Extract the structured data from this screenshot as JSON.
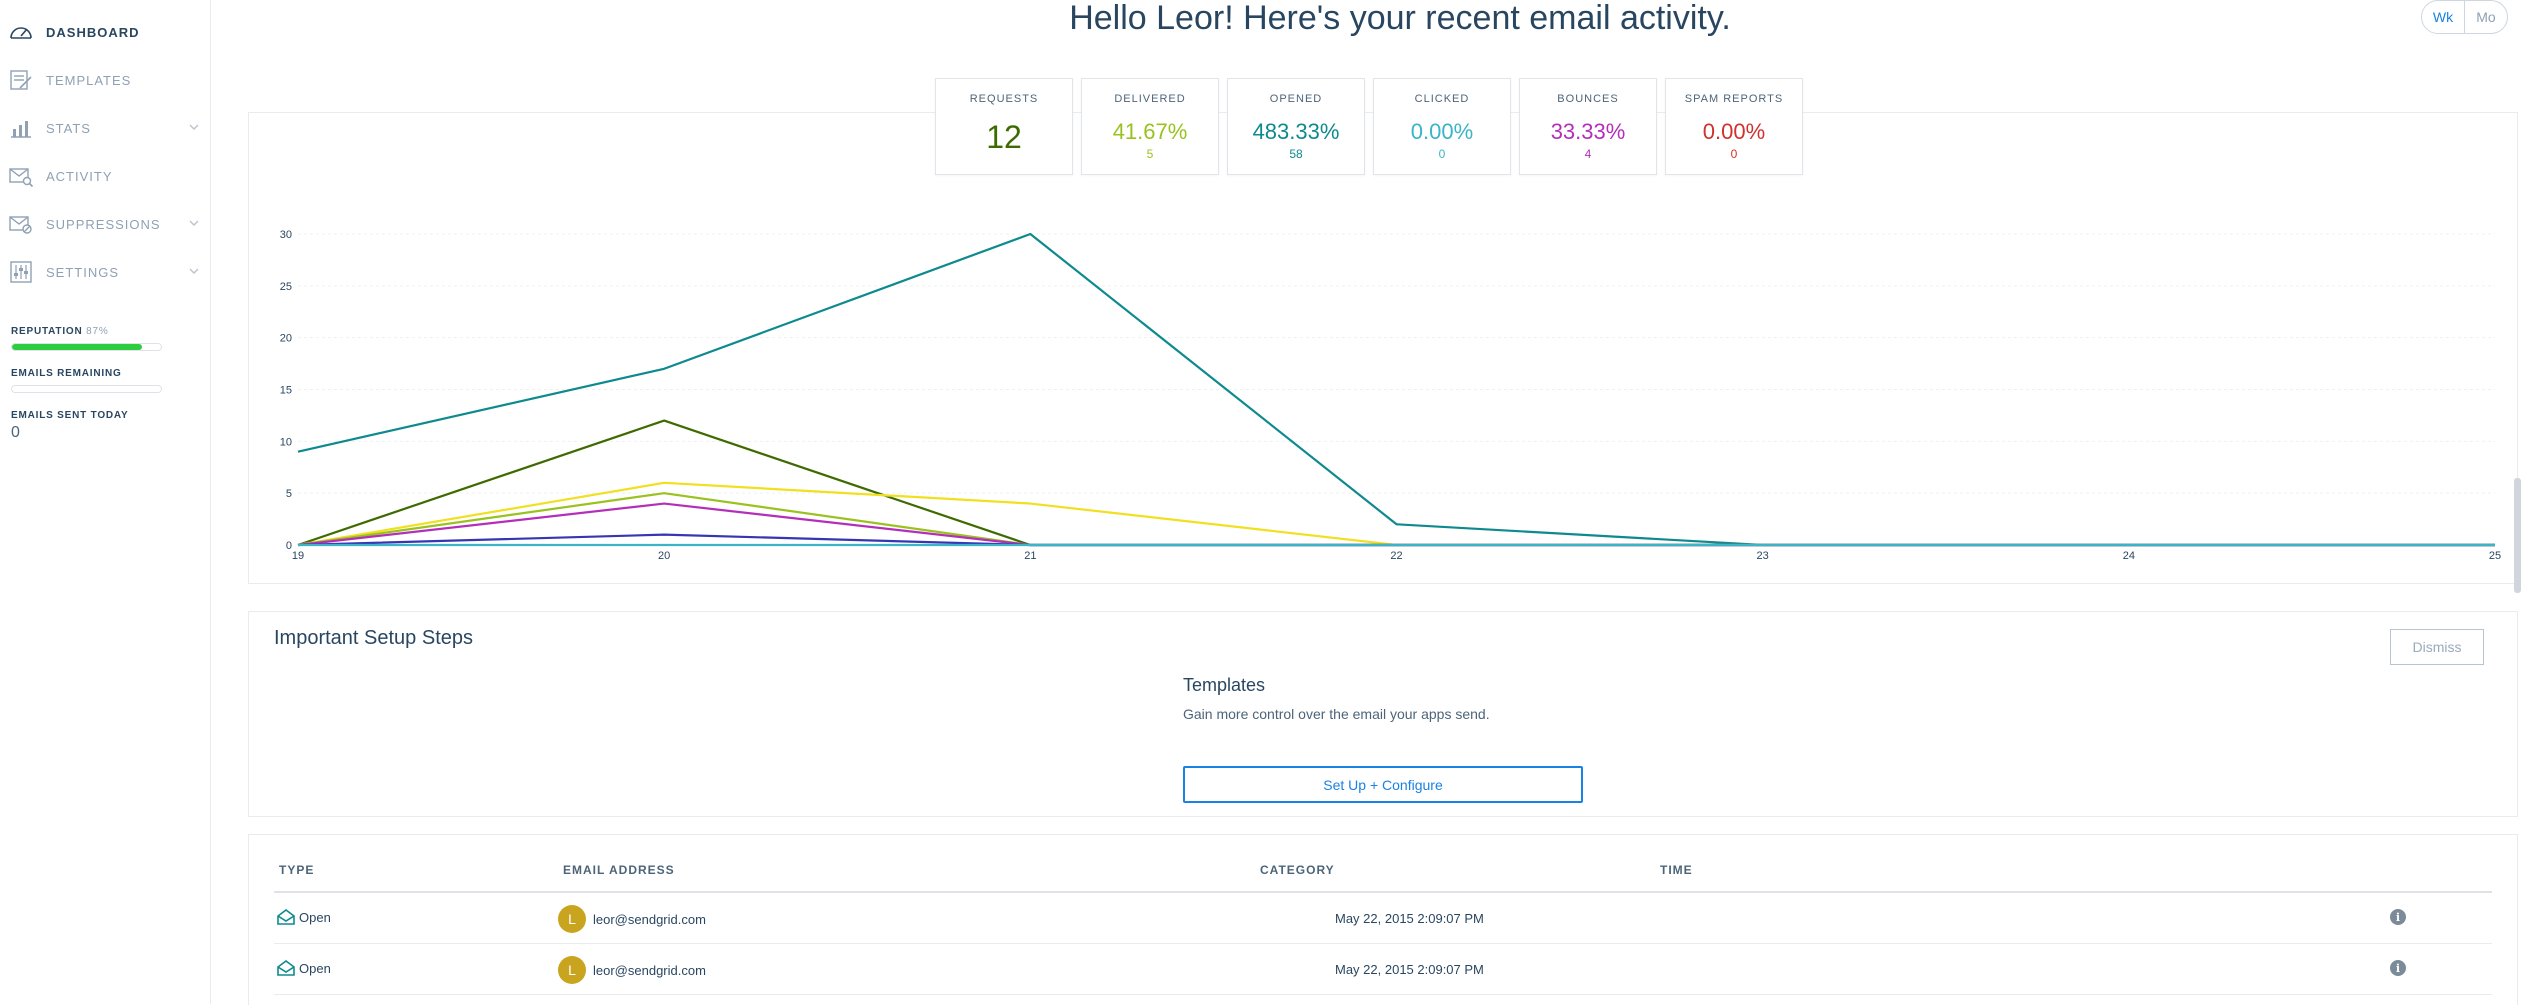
{
  "sidebar": {
    "items": [
      {
        "label": "DASHBOARD",
        "icon": "gauge-icon",
        "active": true,
        "has_submenu": false
      },
      {
        "label": "TEMPLATES",
        "icon": "templates-icon",
        "active": false,
        "has_submenu": false
      },
      {
        "label": "STATS",
        "icon": "stats-icon",
        "active": false,
        "has_submenu": true
      },
      {
        "label": "ACTIVITY",
        "icon": "envelope-search-icon",
        "active": false,
        "has_submenu": false
      },
      {
        "label": "SUPPRESSIONS",
        "icon": "envelope-block-icon",
        "active": false,
        "has_submenu": true
      },
      {
        "label": "SETTINGS",
        "icon": "sliders-icon",
        "active": false,
        "has_submenu": true
      }
    ],
    "reputation": {
      "label": "REPUTATION",
      "value": "87%",
      "fraction": 0.87
    },
    "emails_remaining": {
      "label": "EMAILS REMAINING",
      "fraction": 0
    },
    "emails_sent_today": {
      "label": "EMAILS SENT TODAY",
      "value": "0"
    }
  },
  "header": {
    "title": "Hello Leor! Here's your recent email activity.",
    "toggle": [
      "Wk",
      "Mo"
    ]
  },
  "stats": [
    {
      "label": "REQUESTS",
      "value": "12",
      "sub": "",
      "color": "#3d6b00"
    },
    {
      "label": "DELIVERED",
      "value": "41.67%",
      "sub": "5",
      "color": "#9ac21f"
    },
    {
      "label": "OPENED",
      "value": "483.33%",
      "sub": "58",
      "color": "#0e8a8f"
    },
    {
      "label": "CLICKED",
      "value": "0.00%",
      "sub": "0",
      "color": "#3bb4c8"
    },
    {
      "label": "BOUNCES",
      "value": "33.33%",
      "sub": "4",
      "color": "#b42fb8"
    },
    {
      "label": "SPAM REPORTS",
      "value": "0.00%",
      "sub": "0",
      "color": "#d0312d"
    }
  ],
  "chart_data": {
    "type": "line",
    "x": [
      19,
      20,
      21,
      22,
      23,
      24,
      25
    ],
    "ylim": [
      0,
      30
    ],
    "yticks": [
      0,
      5,
      10,
      15,
      20,
      25,
      30
    ],
    "grid": true,
    "series": [
      {
        "color": "#0e8a8f",
        "values": [
          9,
          17,
          30,
          2,
          0,
          0,
          0
        ]
      },
      {
        "color": "#3d6b00",
        "values": [
          0,
          12,
          0,
          0,
          0,
          0,
          0
        ]
      },
      {
        "color": "#f0e020",
        "values": [
          0,
          6,
          4,
          0,
          0,
          0,
          0
        ]
      },
      {
        "color": "#9ac21f",
        "values": [
          0,
          5,
          0,
          0,
          0,
          0,
          0
        ]
      },
      {
        "color": "#b42fb8",
        "values": [
          0,
          4,
          0,
          0,
          0,
          0,
          0
        ]
      },
      {
        "color": "#3535b5",
        "values": [
          0,
          1,
          0,
          0,
          0,
          0,
          0
        ]
      },
      {
        "color": "#3bb4c8",
        "values": [
          0,
          0,
          0,
          0,
          0,
          0,
          0
        ]
      }
    ]
  },
  "setup": {
    "title": "Important Setup Steps",
    "dismiss_label": "Dismiss",
    "step_title": "Templates",
    "step_desc": "Gain more control over the email your apps send.",
    "button_label": "Set Up + Configure"
  },
  "activity": {
    "columns": [
      "TYPE",
      "EMAIL ADDRESS",
      "CATEGORY",
      "TIME"
    ],
    "rows": [
      {
        "type": "Open",
        "avatar": "L",
        "email": "leor@sendgrid.com",
        "category": "",
        "time": "May 22, 2015 2:09:07 PM"
      },
      {
        "type": "Open",
        "avatar": "L",
        "email": "leor@sendgrid.com",
        "category": "",
        "time": "May 22, 2015 2:09:07 PM"
      }
    ]
  }
}
